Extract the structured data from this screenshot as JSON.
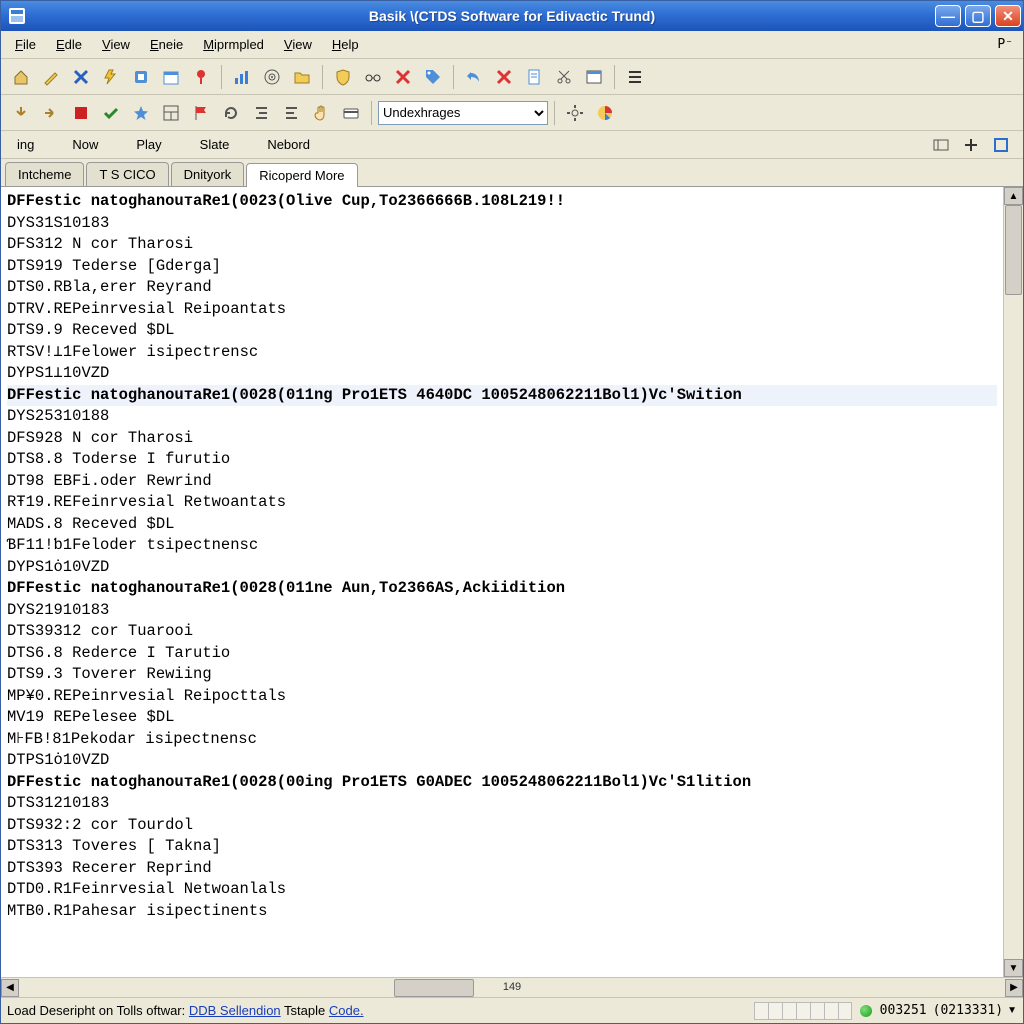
{
  "title": "Basik \\(CTDS Software for Edivactic Trund)",
  "menubar": {
    "items": [
      "File",
      "Edle",
      "View",
      "Eneie",
      "Miprmpled",
      "View",
      "Help"
    ],
    "right_icon": "P⁻"
  },
  "toolbar1": {
    "select_value": "Undexhrages",
    "icons": [
      "home-icon",
      "wizard-icon",
      "delete-x-icon",
      "bolt-icon",
      "tool-icon",
      "calendar-icon",
      "pin-icon",
      "sep",
      "chart-icon",
      "target-icon",
      "folder-open-icon",
      "sep",
      "shield-icon",
      "glasses-icon",
      "red-x-icon",
      "tag-icon",
      "sep",
      "undo-icon",
      "red-x2-icon",
      "doc-icon",
      "cut-icon",
      "window-icon",
      "sep",
      "list-icon"
    ]
  },
  "toolbar2": {
    "icons_left": [
      "arrow-down-icon",
      "arrow-right-icon",
      "stop-icon",
      "check-icon",
      "star-icon",
      "layout-icon",
      "flag-icon",
      "refresh-icon",
      "indent-icon",
      "outdent-icon",
      "hand-icon",
      "card-icon"
    ],
    "icons_right": [
      "gear-icon",
      "pie-icon"
    ]
  },
  "small_toolbar": {
    "items": [
      "ing",
      "Now",
      "Play",
      "Slate",
      "Nebord"
    ],
    "right_icons": [
      "panel-icon",
      "plus-icon",
      "expand-icon"
    ]
  },
  "tabs": {
    "items": [
      "Intcheme",
      "T S CICO",
      "Dnityork",
      "Ricoperd More"
    ],
    "active_index": 3
  },
  "log": {
    "lines": [
      {
        "t": "DFFestic natoghanouтaRe1(0023(Olive Cup,To2366666B.108L219!!",
        "bold": true
      },
      {
        "t": "DYS31S10183"
      },
      {
        "t": "DFS312 N cor Tharosi"
      },
      {
        "t": "DTS919 Tederse [Gderga]"
      },
      {
        "t": "DTS0.RBla,erer Reyrand"
      },
      {
        "t": "DTRV.REPeinrvesial Reipoantats"
      },
      {
        "t": "DTS9.9 Receved $DL"
      },
      {
        "t": "RTSV!⊥1Felower isipectrensc"
      },
      {
        "t": "DYPS1⊥10VZD"
      },
      {
        "t": "DFFestic natoghanouтaRe1(0028(011ng Pro1ETS 4640DC 1005248062211Bol1)Vc'Swition",
        "bold": true,
        "hl": true
      },
      {
        "t": "DYS25310188"
      },
      {
        "t": "DFS928 N cor Tharosi"
      },
      {
        "t": "DTS8.8 Toderse I furutio"
      },
      {
        "t": "DT98 EBFi.oder Rewrind"
      },
      {
        "t": "RŦ19.REFeinrvesial Retwoantats"
      },
      {
        "t": "MADS.8 Receved $DL"
      },
      {
        "t": "ƁF11!ƅ1Feloder tsipectnensc"
      },
      {
        "t": "DYPS1ȯ10VZD"
      },
      {
        "t": "DFFestic natoghanouтaRe1(0028(011ne Aun,To2366AS,Ackiidition",
        "bold": true
      },
      {
        "t": "DYS21910183"
      },
      {
        "t": "DTS39312 cor Tuarooi"
      },
      {
        "t": "DTS6.8 Rederce I Tarutio"
      },
      {
        "t": "DTS9.3 Toverer Rewiing"
      },
      {
        "t": "MP¥0.REPeinrvesial Reipocttals"
      },
      {
        "t": "MV19 REPelesee $DL"
      },
      {
        "t": "M⊦FB!81Pekodar isipectnensc"
      },
      {
        "t": "DTPS1ȯ10VZD"
      },
      {
        "t": "DFFestic natoghanouтaRe1(0028(00ing Pro1ETS G0ADEC 1005248062211Bol1)Vc'S1lition",
        "bold": true
      },
      {
        "t": "DTS31210183"
      },
      {
        "t": "DTS932:2 cor Tourdol"
      },
      {
        "t": "DTS313 Toveres [ Takna]"
      },
      {
        "t": "DTS393 Recerer Reprind"
      },
      {
        "t": "DTD0.R1Feinrvesial Netwoanlals"
      },
      {
        "t": "MTB0.R1Pahesar isipectinents"
      }
    ]
  },
  "hscroll": {
    "page_label": "149"
  },
  "statusbar": {
    "prefix": "Load Deseripht on Tolls oftwar: ",
    "link1": "DDB Sellendion",
    "mid": " Tstaple ",
    "link2": "Code.",
    "cells": 7,
    "num1": "003251",
    "num2": "(0213331)"
  },
  "colors": {
    "title_grad_top": "#4a8de0",
    "accent": "#2f6ed4"
  }
}
